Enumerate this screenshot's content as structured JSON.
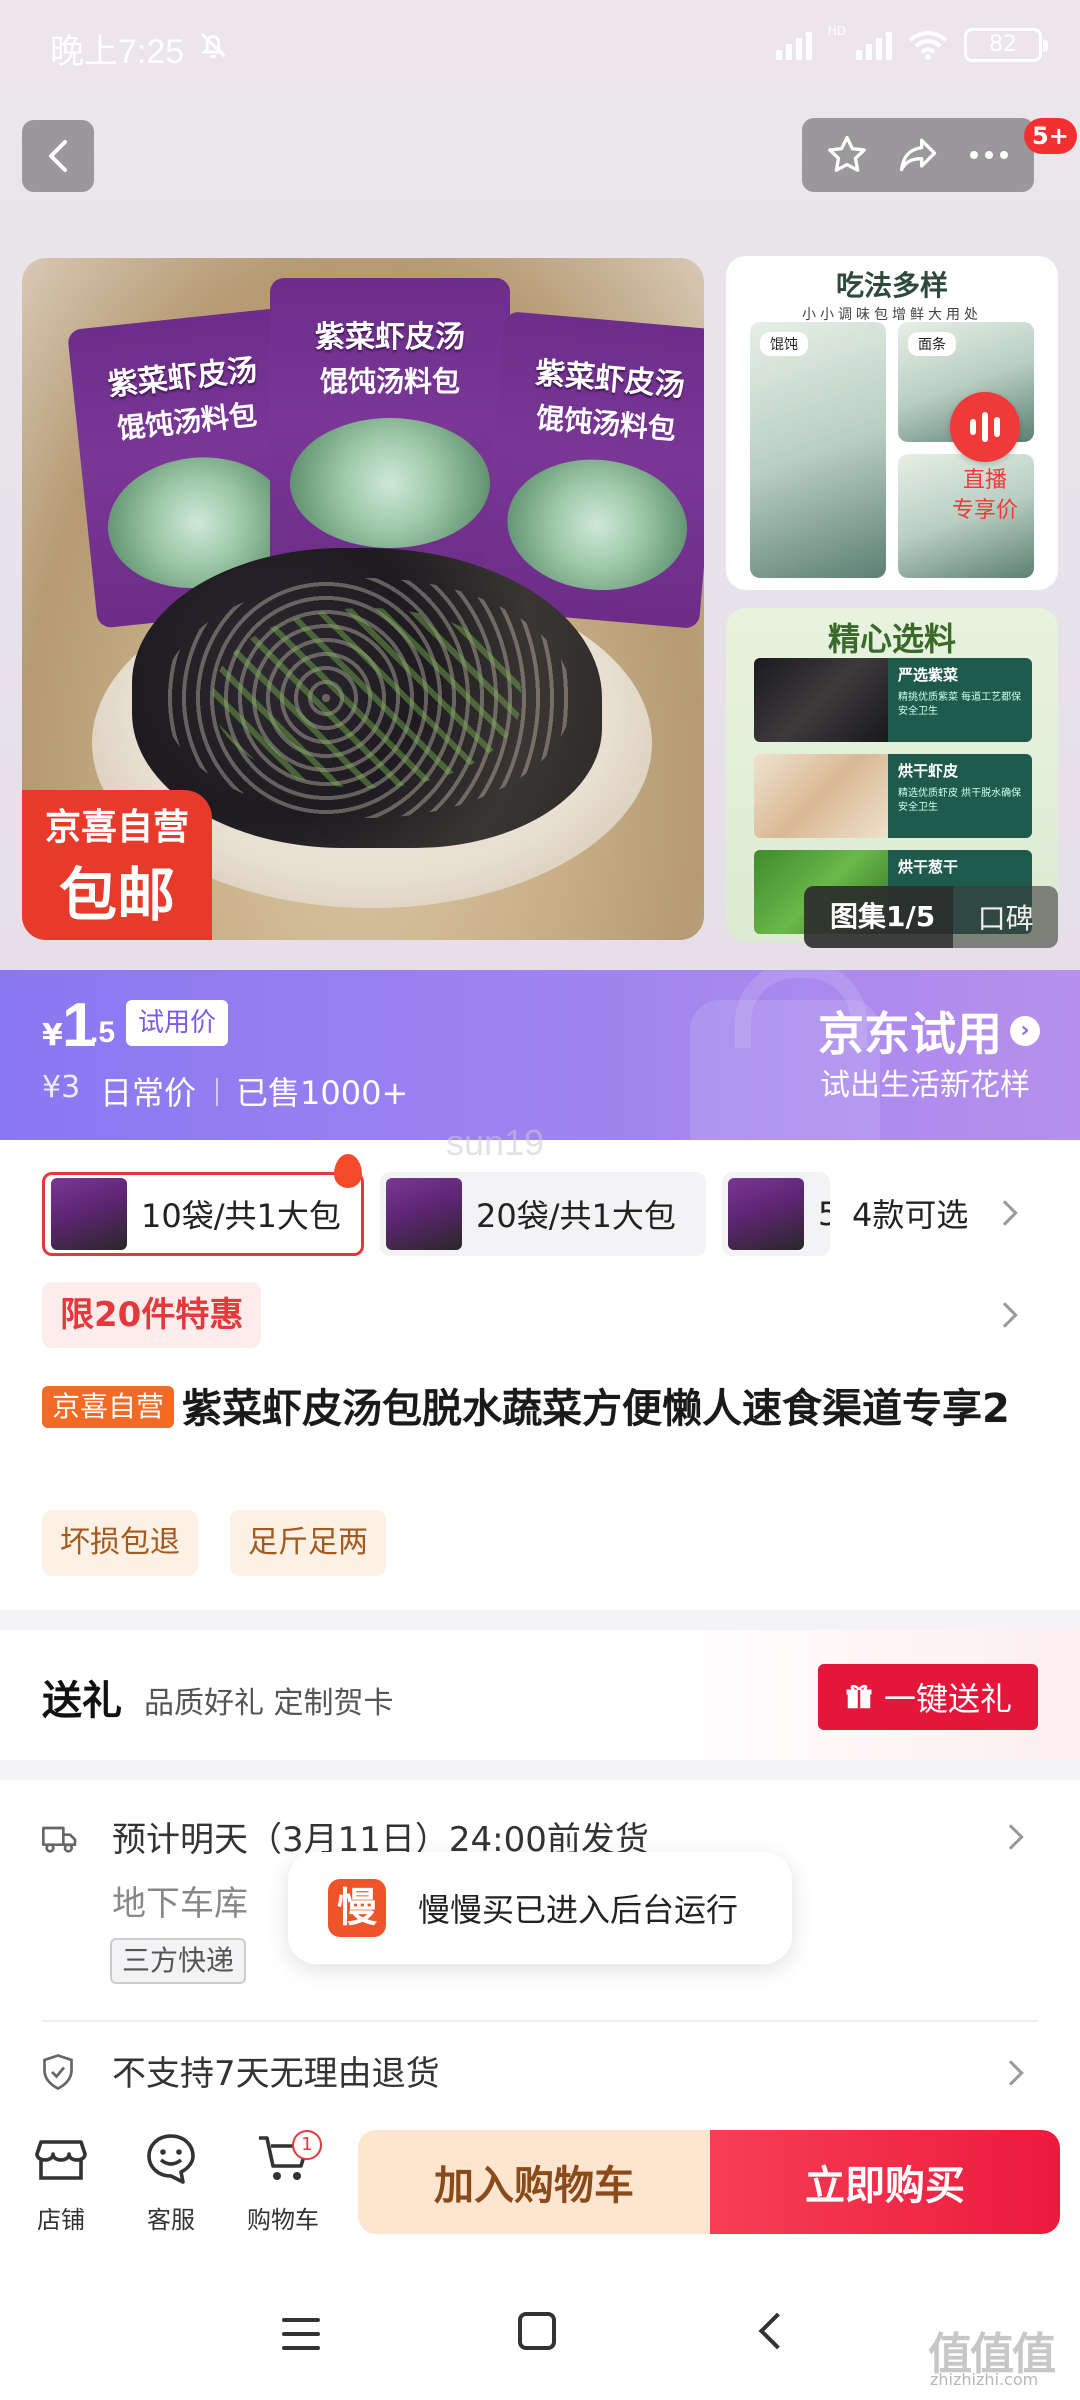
{
  "status_bar": {
    "time": "晚上7:25",
    "hd": "HD",
    "battery": "82"
  },
  "nav": {
    "more_badge": "5+"
  },
  "gallery": {
    "main_packs": [
      {
        "title": "紫菜虾皮汤",
        "sub": "馄饨汤料包"
      },
      {
        "title": "紫菜虾皮汤",
        "sub": "馄饨汤料包"
      }
    ],
    "badge_line1": "京喜自营",
    "badge_line2": "包邮",
    "side1_title": "吃法多样",
    "side1_sub": "小小调味包增鲜大用处",
    "side1_labels": [
      "馄饨",
      "面条"
    ],
    "live_label": "直播",
    "live_sub": "专享价",
    "side2_title": "精心选料",
    "side2_rows": [
      {
        "name": "严选紫菜",
        "desc": "精挑优质紫菜 每道工艺都保安全卫生"
      },
      {
        "name": "烘干虾皮",
        "desc": "精选优质虾皮 烘干脱水确保安全卫生"
      },
      {
        "name": "烘干葱干",
        "desc": ""
      }
    ],
    "tab_active": "图集1/5",
    "tab_other": "口碑"
  },
  "trial": {
    "yen": "¥",
    "price_int": "1",
    "price_dec": ".5",
    "tag": "试用价",
    "old_price": "¥3",
    "daily_label": "日常价",
    "sold": "已售1000+",
    "brand": "京东试用",
    "slogan": "试出生活新花样"
  },
  "watermark": "sun19",
  "sku": {
    "options": [
      "10袋/共1大包",
      "20袋/共1大包",
      "5"
    ],
    "count": "4款可选"
  },
  "limit_tag": "限20件特惠",
  "product": {
    "store_tag": "京喜自营",
    "title": "紫菜虾皮汤包脱水蔬菜方便懒人速食渠道专享2"
  },
  "services": [
    "坏损包退",
    "足斤足两"
  ],
  "gift": {
    "title": "送礼",
    "sub": "品质好礼 定制贺卡",
    "button": "一键送礼"
  },
  "shipping": {
    "main": "预计明天（3月11日）24:00前发货",
    "addr": "地下车库",
    "carrier": "三方快递",
    "return_policy": "不支持7天无理由退货"
  },
  "toast": {
    "logo": "慢",
    "message": "慢慢买已进入后台运行"
  },
  "actions": {
    "shop": "店铺",
    "service": "客服",
    "cart": "购物车",
    "cart_count": "1",
    "add_to_cart": "加入购物车",
    "buy_now": "立即购买"
  },
  "site_watermark": {
    "logo": "值值值",
    "url": "zhizhizhi.com"
  },
  "colors": {
    "jd_red": "#e4393c",
    "trial_purple": "#8a78f2",
    "buy_red": "#ec1a3d",
    "cart_bg": "#fde5cf"
  }
}
